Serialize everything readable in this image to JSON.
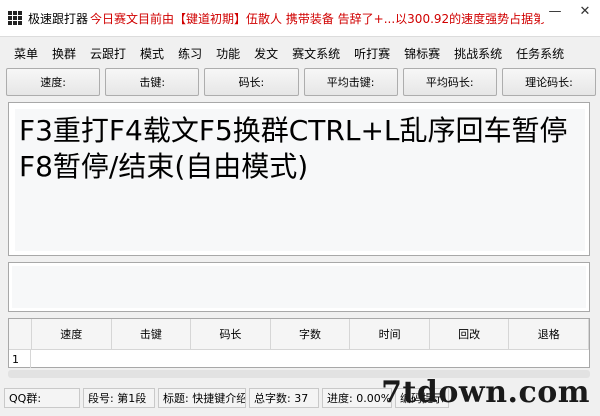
{
  "window": {
    "title": "极速跟打器",
    "marquee_prefix": "今日赛文目前由",
    "marquee_highlight": "【键道初期】",
    "marquee_rest": "伍散人 携带装备 告辞了+...以300.92的速度强势占据第",
    "minimize": "—",
    "close": "✕"
  },
  "menu": {
    "items": [
      "菜单",
      "换群",
      "云跟打",
      "模式",
      "练习",
      "功能",
      "发文",
      "赛文系统",
      "听打赛",
      "锦标赛",
      "挑战系统",
      "任务系统"
    ]
  },
  "stats": {
    "speed": "速度:",
    "keystroke": "击键:",
    "code_length": "码长:",
    "avg_keystroke": "平均击键:",
    "avg_code_length": "平均码长:",
    "theory_code_length": "理论码长:"
  },
  "article": {
    "text": "F3重打F4载文F5换群CTRL+L乱序回车暂停F8暂停/结束(自由模式)"
  },
  "results": {
    "columns": [
      "速度",
      "击键",
      "码长",
      "字数",
      "时间",
      "回改",
      "退格"
    ],
    "row_number": "1"
  },
  "status": {
    "qq_group": "QQ群:",
    "segment": "段号: 第1段",
    "title": "标题: 快捷键介绍",
    "total_chars": "总字数: 37",
    "progress": "进度: 0.00%",
    "encoding_hint": "编码提示"
  },
  "watermark": {
    "text": "7tdown.com"
  }
}
